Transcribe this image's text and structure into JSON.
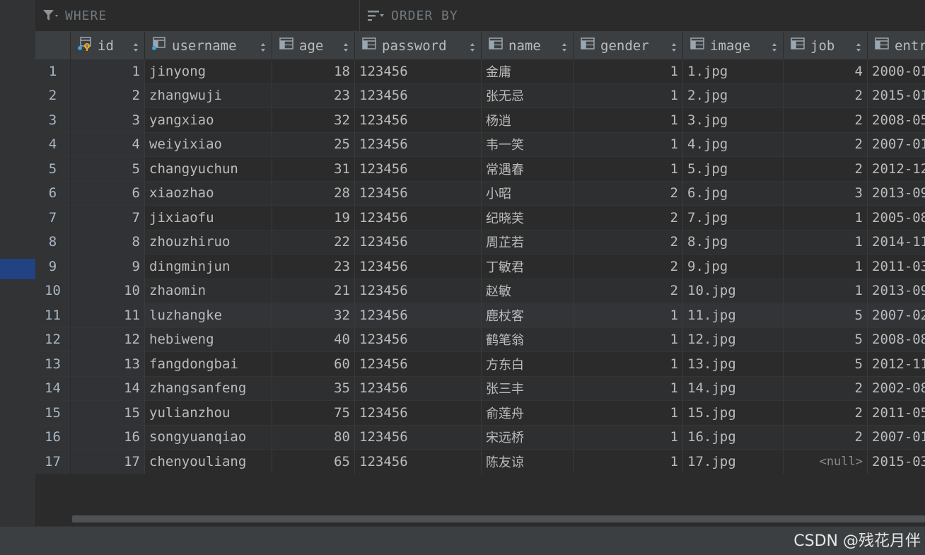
{
  "filter": {
    "where_label": "WHERE",
    "order_label": "ORDER BY"
  },
  "columns": [
    {
      "key": "id",
      "label": "id",
      "icon": "primary-key-column-icon"
    },
    {
      "key": "username",
      "label": "username",
      "icon": "indexed-column-icon"
    },
    {
      "key": "age",
      "label": "age",
      "icon": "column-icon"
    },
    {
      "key": "password",
      "label": "password",
      "icon": "column-icon"
    },
    {
      "key": "name",
      "label": "name",
      "icon": "column-icon"
    },
    {
      "key": "gender",
      "label": "gender",
      "icon": "column-icon"
    },
    {
      "key": "image",
      "label": "image",
      "icon": "column-icon"
    },
    {
      "key": "job",
      "label": "job",
      "icon": "column-icon"
    },
    {
      "key": "entrydate",
      "label": "entr",
      "icon": "column-icon"
    }
  ],
  "rows": [
    {
      "n": "1",
      "id": "1",
      "username": "jinyong",
      "age": "18",
      "password": "123456",
      "name": "金庸",
      "gender": "1",
      "image": "1.jpg",
      "job": "4",
      "entrydate": "2000-01"
    },
    {
      "n": "2",
      "id": "2",
      "username": "zhangwuji",
      "age": "23",
      "password": "123456",
      "name": "张无忌",
      "gender": "1",
      "image": "2.jpg",
      "job": "2",
      "entrydate": "2015-01"
    },
    {
      "n": "3",
      "id": "3",
      "username": "yangxiao",
      "age": "32",
      "password": "123456",
      "name": "杨逍",
      "gender": "1",
      "image": "3.jpg",
      "job": "2",
      "entrydate": "2008-05"
    },
    {
      "n": "4",
      "id": "4",
      "username": "weiyixiao",
      "age": "25",
      "password": "123456",
      "name": "韦一笑",
      "gender": "1",
      "image": "4.jpg",
      "job": "2",
      "entrydate": "2007-01"
    },
    {
      "n": "5",
      "id": "5",
      "username": "changyuchun",
      "age": "31",
      "password": "123456",
      "name": "常遇春",
      "gender": "1",
      "image": "5.jpg",
      "job": "2",
      "entrydate": "2012-12"
    },
    {
      "n": "6",
      "id": "6",
      "username": "xiaozhao",
      "age": "28",
      "password": "123456",
      "name": "小昭",
      "gender": "2",
      "image": "6.jpg",
      "job": "3",
      "entrydate": "2013-09"
    },
    {
      "n": "7",
      "id": "7",
      "username": "jixiaofu",
      "age": "19",
      "password": "123456",
      "name": "纪晓芙",
      "gender": "2",
      "image": "7.jpg",
      "job": "1",
      "entrydate": "2005-08"
    },
    {
      "n": "8",
      "id": "8",
      "username": "zhouzhiruo",
      "age": "22",
      "password": "123456",
      "name": "周芷若",
      "gender": "2",
      "image": "8.jpg",
      "job": "1",
      "entrydate": "2014-11"
    },
    {
      "n": "9",
      "id": "9",
      "username": "dingminjun",
      "age": "23",
      "password": "123456",
      "name": "丁敏君",
      "gender": "2",
      "image": "9.jpg",
      "job": "1",
      "entrydate": "2011-03"
    },
    {
      "n": "10",
      "id": "10",
      "username": "zhaomin",
      "age": "21",
      "password": "123456",
      "name": "赵敏",
      "gender": "2",
      "image": "10.jpg",
      "job": "1",
      "entrydate": "2013-09"
    },
    {
      "n": "11",
      "id": "11",
      "username": "luzhangke",
      "age": "32",
      "password": "123456",
      "name": "鹿杖客",
      "gender": "1",
      "image": "11.jpg",
      "job": "5",
      "entrydate": "2007-02"
    },
    {
      "n": "12",
      "id": "12",
      "username": "hebiweng",
      "age": "40",
      "password": "123456",
      "name": "鹤笔翁",
      "gender": "1",
      "image": "12.jpg",
      "job": "5",
      "entrydate": "2008-08"
    },
    {
      "n": "13",
      "id": "13",
      "username": "fangdongbai",
      "age": "60",
      "password": "123456",
      "name": "方东白",
      "gender": "1",
      "image": "13.jpg",
      "job": "5",
      "entrydate": "2012-11"
    },
    {
      "n": "14",
      "id": "14",
      "username": "zhangsanfeng",
      "age": "35",
      "password": "123456",
      "name": "张三丰",
      "gender": "1",
      "image": "14.jpg",
      "job": "2",
      "entrydate": "2002-08"
    },
    {
      "n": "15",
      "id": "15",
      "username": "yulianzhou",
      "age": "75",
      "password": "123456",
      "name": "俞莲舟",
      "gender": "1",
      "image": "15.jpg",
      "job": "2",
      "entrydate": "2011-05"
    },
    {
      "n": "16",
      "id": "16",
      "username": "songyuanqiao",
      "age": "80",
      "password": "123456",
      "name": "宋远桥",
      "gender": "1",
      "image": "16.jpg",
      "job": "2",
      "entrydate": "2007-01"
    },
    {
      "n": "17",
      "id": "17",
      "username": "chenyouliang",
      "age": "65",
      "password": "123456",
      "name": "陈友谅",
      "gender": "1",
      "image": "17.jpg",
      "job": "<null>",
      "entrydate": "2015-03"
    }
  ],
  "watermark": "CSDN @残花月伴"
}
